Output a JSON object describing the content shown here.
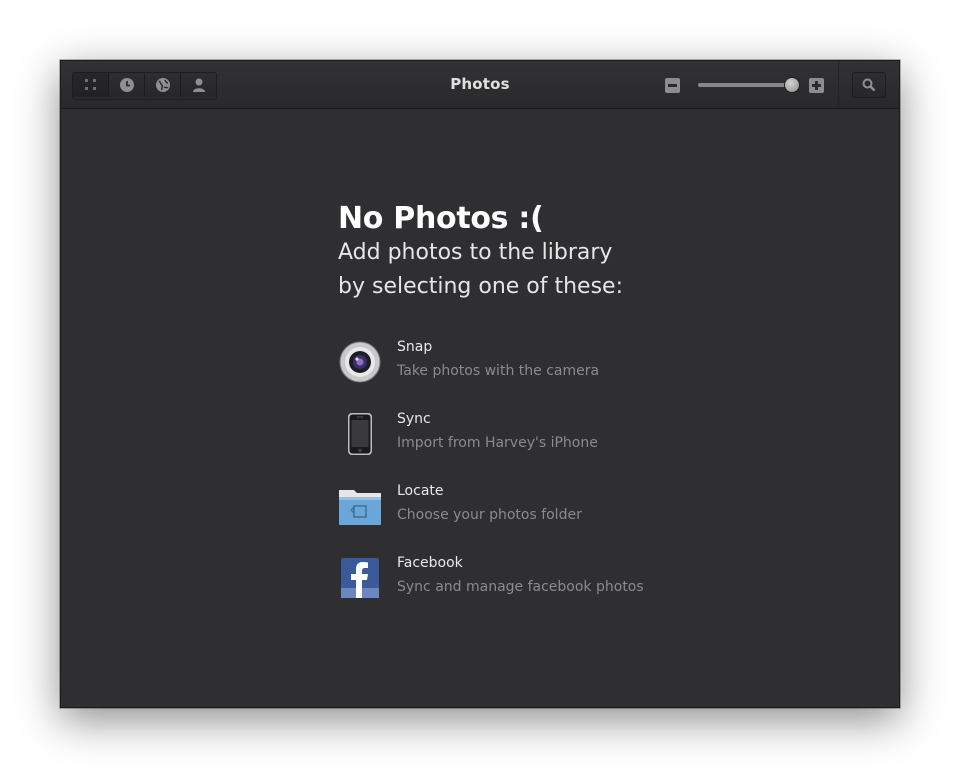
{
  "window": {
    "title": "Photos"
  },
  "toolbar": {
    "view_buttons": [
      {
        "icon": "grid-icon",
        "active": true
      },
      {
        "icon": "clock-icon",
        "active": false
      },
      {
        "icon": "globe-icon",
        "active": false
      },
      {
        "icon": "person-icon",
        "active": false
      }
    ],
    "zoom_level": 1.0
  },
  "empty_state": {
    "heading": "No Photos :(",
    "subtitle": "Add photos to the library\nby selecting one of these:",
    "options": [
      {
        "title": "Snap",
        "description": "Take photos with the camera",
        "icon": "camera-icon"
      },
      {
        "title": "Sync",
        "description": "Import from Harvey's iPhone",
        "icon": "phone-icon"
      },
      {
        "title": "Locate",
        "description": "Choose your photos folder",
        "icon": "folder-icon"
      },
      {
        "title": "Facebook",
        "description": "Sync and manage facebook photos",
        "icon": "facebook-icon"
      }
    ]
  },
  "colors": {
    "window_bg": "#2f2f31",
    "titlebar": "#2d2d2f",
    "heading_text": "#ffffff",
    "desc_text": "#8b8b8d"
  }
}
